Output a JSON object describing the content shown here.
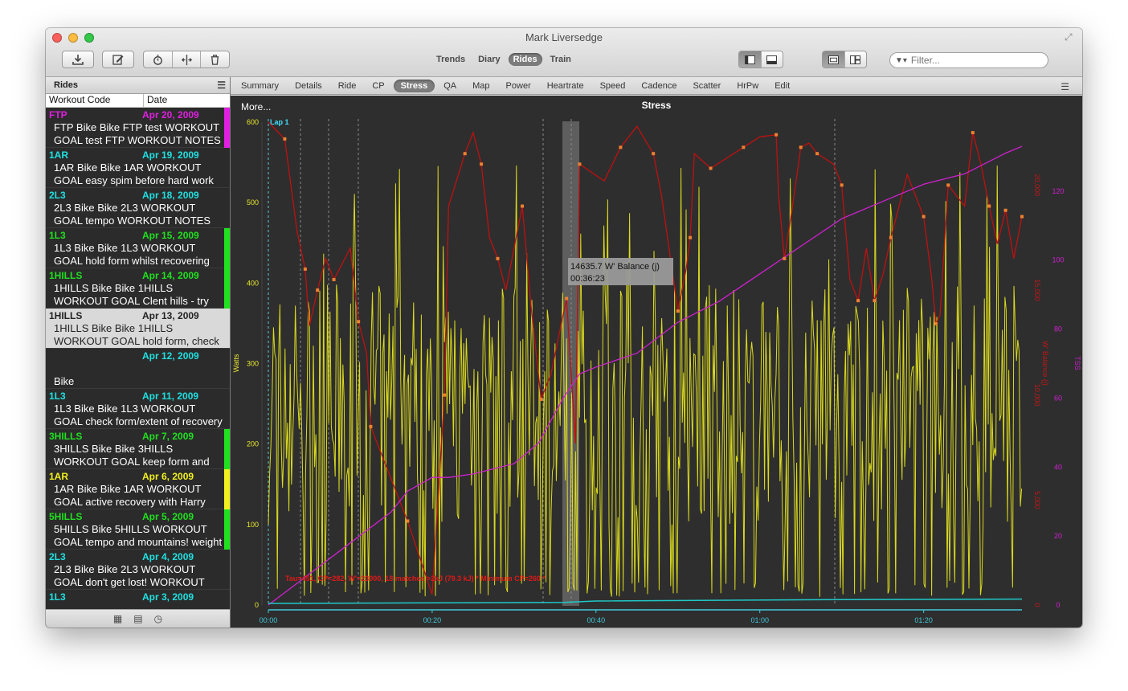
{
  "window": {
    "title": "Mark Liversedge"
  },
  "toolbar": {
    "views": [
      "Trends",
      "Diary",
      "Rides",
      "Train"
    ],
    "selected_view": "Rides",
    "filter_placeholder": "Filter..."
  },
  "sidebar": {
    "title": "Rides",
    "columns": [
      "Workout Code",
      "Date"
    ],
    "rides": [
      {
        "code": "FTP",
        "date": "Apr 20, 2009",
        "line1": "FTP Bike Bike FTP test WORKOUT",
        "line2": "GOAL test FTP  WORKOUT NOTES",
        "color": "#e020e0",
        "bar": "#e020e0"
      },
      {
        "code": "1AR",
        "date": "Apr 19, 2009",
        "line1": "1AR Bike Bike 1AR WORKOUT",
        "line2": "GOAL easy spim before hard work",
        "color": "#20e0e0",
        "bar": ""
      },
      {
        "code": "2L3",
        "date": "Apr 18, 2009",
        "line1": "2L3 Bike Bike 2L3 WORKOUT",
        "line2": "GOAL tempo WORKOUT NOTES",
        "color": "#20e0e0",
        "bar": ""
      },
      {
        "code": "1L3",
        "date": "Apr 15, 2009",
        "line1": "1L3 Bike Bike 1L3 WORKOUT",
        "line2": "GOAL hold form whilst recovering",
        "color": "#20e020",
        "bar": "#20e020"
      },
      {
        "code": "1HILLS",
        "date": "Apr 14, 2009",
        "line1": "1HILLS Bike Bike 1HILLS",
        "line2": "WORKOUT GOAL Clent hills - try",
        "color": "#20e020",
        "bar": "#20e020"
      },
      {
        "code": "1HILLS",
        "date": "Apr 13, 2009",
        "line1": "1HILLS Bike Bike 1HILLS",
        "line2": "WORKOUT GOAL hold form, check",
        "color": "#222222",
        "bar": "",
        "selected": true
      },
      {
        "code": "",
        "date": "Apr 12, 2009",
        "line1": "",
        "line2": "Bike",
        "color": "#20e0e0",
        "bar": ""
      },
      {
        "code": "1L3",
        "date": "Apr 11, 2009",
        "line1": "1L3 Bike Bike 1L3 WORKOUT",
        "line2": "GOAL check form/extent of recovery",
        "color": "#20e0e0",
        "bar": ""
      },
      {
        "code": "3HILLS",
        "date": "Apr 7, 2009",
        "line1": "3HILLS Bike Bike 3HILLS",
        "line2": "WORKOUT GOAL keep form and",
        "color": "#20e020",
        "bar": "#20e020"
      },
      {
        "code": "1AR",
        "date": "Apr 6, 2009",
        "line1": "1AR Bike Bike 1AR WORKOUT",
        "line2": "GOAL active recovery with Harry",
        "color": "#f0f020",
        "bar": "#f0f020"
      },
      {
        "code": "5HILLS",
        "date": "Apr 5, 2009",
        "line1": "5HILLS Bike 5HILLS WORKOUT",
        "line2": "GOAL tempo and mountains! weight",
        "color": "#20e020",
        "bar": "#20e020"
      },
      {
        "code": "2L3",
        "date": "Apr 4, 2009",
        "line1": "2L3 Bike Bike 2L3 WORKOUT",
        "line2": "GOAL don't get lost! WORKOUT",
        "color": "#20e0e0",
        "bar": ""
      },
      {
        "code": "1L3",
        "date": "Apr 3, 2009",
        "line1": "",
        "line2": "",
        "color": "#20e0e0",
        "bar": ""
      }
    ]
  },
  "tabs": {
    "items": [
      "Summary",
      "Details",
      "Ride",
      "CP",
      "Stress",
      "QA",
      "Map",
      "Power",
      "Heartrate",
      "Speed",
      "Cadence",
      "Scatter",
      "HrPw",
      "Edit"
    ],
    "selected": "Stress"
  },
  "chart_data": {
    "type": "line",
    "title": "Stress",
    "more_label": "More...",
    "lap_label": "Lap 1",
    "x_ticks": [
      "00:00",
      "00:20",
      "00:40",
      "01:00",
      "01:20"
    ],
    "x_range_minutes": [
      0,
      92
    ],
    "y_left": {
      "label": "Watts",
      "ticks": [
        0,
        100,
        200,
        300,
        400,
        500,
        600
      ],
      "range": [
        0,
        600
      ]
    },
    "y_mid": {
      "label": "W' Balance (j)",
      "ticks": [
        "0",
        "5,000",
        "10,000",
        "15,000",
        "20,000"
      ],
      "range": [
        0,
        23000
      ]
    },
    "y_right": {
      "label": "TSS",
      "ticks": [
        0,
        20,
        40,
        60,
        80,
        100,
        120
      ],
      "range": [
        0,
        140
      ]
    },
    "annotation": "Tau=451, CP=282, W'=23000, 18 matches >2kJ (79.3 kJ) * Minimum CP=260 *",
    "tooltip": {
      "line1": "14635.7 W' Balance (j)",
      "line2": "00:36:23"
    },
    "series": [
      {
        "name": "W' Balance (j)",
        "color": "#c01010",
        "t": [
          0,
          2,
          3.5,
          4.5,
          5,
          6,
          7,
          8,
          10,
          11,
          12,
          12.5,
          14,
          17,
          20,
          21.5,
          22,
          24,
          25,
          26,
          27,
          28,
          29,
          31,
          32,
          33.3,
          34.5,
          36.4,
          37.5,
          38,
          41,
          43,
          45,
          47,
          48,
          50,
          51,
          51.5,
          52,
          54,
          56,
          58,
          60,
          62,
          62.3,
          63,
          64,
          65,
          66,
          67,
          69,
          70,
          71,
          72,
          73,
          74,
          75,
          76,
          78,
          80,
          81,
          81.5,
          82,
          83,
          85,
          86,
          87,
          88,
          89,
          90,
          91,
          92
        ],
        "v": [
          23000,
          22200,
          17800,
          16000,
          13300,
          15000,
          16500,
          15500,
          17000,
          13500,
          12000,
          8500,
          7000,
          4000,
          500,
          10000,
          19000,
          21500,
          22500,
          21000,
          17500,
          16500,
          15000,
          19000,
          14500,
          9800,
          11000,
          14600,
          7700,
          21000,
          20200,
          21800,
          22800,
          21500,
          19500,
          14000,
          16000,
          17500,
          21500,
          20800,
          21300,
          21800,
          22300,
          22400,
          19500,
          16500,
          19000,
          21800,
          22000,
          21500,
          21000,
          20000,
          15500,
          14500,
          17000,
          14500,
          15700,
          17500,
          20500,
          18500,
          15500,
          13400,
          13800,
          20000,
          19000,
          22500,
          21000,
          19000,
          17200,
          18800,
          16500,
          18500
        ]
      },
      {
        "name": "TSS",
        "color": "#d020d0",
        "t": [
          0,
          5,
          10,
          15,
          17,
          20,
          22,
          25,
          30,
          33,
          36,
          38,
          40,
          45,
          50,
          55,
          60,
          65,
          70,
          75,
          80,
          85,
          90,
          92
        ],
        "v": [
          0,
          9,
          18,
          27,
          33,
          37,
          37,
          38,
          41,
          47,
          60,
          67,
          69,
          73,
          82,
          88,
          96,
          104,
          112,
          117,
          122,
          125,
          131,
          133
        ]
      },
      {
        "name": "Cadence",
        "color": "#20c8c8",
        "t": [
          0,
          36,
          40,
          70,
          92
        ],
        "v": [
          0,
          2,
          5,
          8,
          9
        ]
      }
    ]
  }
}
